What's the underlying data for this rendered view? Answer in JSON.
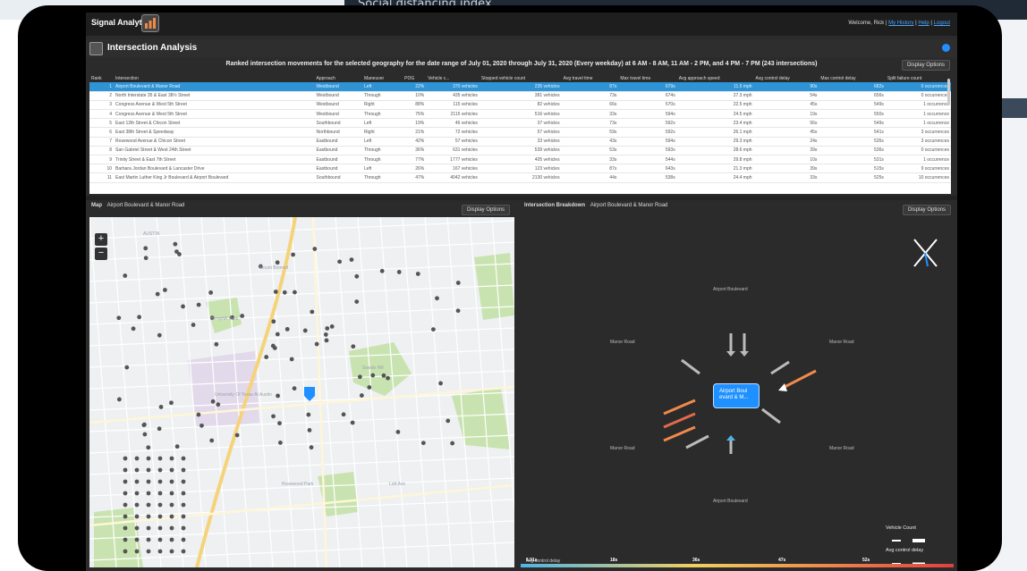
{
  "background": {
    "title": "Social distancing index"
  },
  "app": {
    "name": "Signal Analytics",
    "welcome": "Welcome, Rick |",
    "links": [
      "My History",
      "Help",
      "Logout"
    ],
    "accent": "#1e90ff"
  },
  "section": {
    "title": "Intersection Analysis"
  },
  "ranked_text": "Ranked intersection movements for the selected geography for the date range of July 01, 2020 through July 31, 2020 (Every weekday) at 6 AM - 8 AM, 11 AM - 2 PM, and 4 PM - 7 PM (243 intersections)",
  "display_options": "Display Options",
  "table": {
    "columns": [
      "Rank",
      "Intersection",
      "Approach",
      "Maneuver",
      "POG",
      "Vehicle c...",
      "Stopped vehicle count",
      "Avg travel time",
      "Max travel time",
      "Avg approach speed",
      "Avg control delay",
      "Max control delay",
      "Split failure count"
    ],
    "rows": [
      [
        "1",
        "Airport Boulevard & Manor Road",
        "Westbound",
        "Left",
        "22%",
        "370 vehicles",
        "235 vehicles",
        "87s",
        "679s",
        "11.5 mph",
        "90s",
        "682s",
        "0 occurrences"
      ],
      [
        "2",
        "North Interstate 35 & East 38½ Street",
        "Westbound",
        "Through",
        "10%",
        "435 vehicles",
        "381 vehicles",
        "73s",
        "674s",
        "27.3 mph",
        "54s",
        "656s",
        "0 occurrences"
      ],
      [
        "3",
        "Congress Avenue & West 5th Street",
        "Westbound",
        "Right",
        "88%",
        "115 vehicles",
        "82 vehicles",
        "66s",
        "570s",
        "22.5 mph",
        "45s",
        "549s",
        "1 occurrence"
      ],
      [
        "4",
        "Congress Avenue & West 5th Street",
        "Westbound",
        "Through",
        "75%",
        "2115 vehicles",
        "516 vehicles",
        "33s",
        "594s",
        "24.5 mph",
        "19s",
        "550s",
        "1 occurrence"
      ],
      [
        "5",
        "East 12th Street & Chicon Street",
        "Southbound",
        "Left",
        "19%",
        "46 vehicles",
        "37 vehicles",
        "73s",
        "592s",
        "23.4 mph",
        "56s",
        "549s",
        "1 occurrence"
      ],
      [
        "6",
        "East 38th Street & Speedway",
        "Northbound",
        "Right",
        "21%",
        "72 vehicles",
        "57 vehicles",
        "59s",
        "592s",
        "26.1 mph",
        "45s",
        "541s",
        "3 occurrences"
      ],
      [
        "7",
        "Rosewood Avenue & Chicon Street",
        "Eastbound",
        "Left",
        "42%",
        "57 vehicles",
        "33 vehicles",
        "43s",
        "594s",
        "29.3 mph",
        "24s",
        "535s",
        "3 occurrences"
      ],
      [
        "8",
        "San Gabriel Street & West 24th Street",
        "Eastbound",
        "Through",
        "36%",
        "631 vehicles",
        "539 vehicles",
        "53s",
        "593s",
        "28.6 mph",
        "39s",
        "536s",
        "0 occurrences"
      ],
      [
        "9",
        "Trinity Street & East 7th Street",
        "Eastbound",
        "Through",
        "77%",
        "1777 vehicles",
        "405 vehicles",
        "33s",
        "544s",
        "29.8 mph",
        "10s",
        "531s",
        "1 occurrence"
      ],
      [
        "10",
        "Barbara Jordan Boulevard & Lancaster Drive",
        "Eastbound",
        "Left",
        "26%",
        "167 vehicles",
        "123 vehicles",
        "87s",
        "643s",
        "21.3 mph",
        "39s",
        "515s",
        "9 occurrences"
      ],
      [
        "11",
        "East Martin Luther King Jr Boulevard & Airport Boulevard",
        "Southbound",
        "Through",
        "47%",
        "4042 vehicles",
        "2130 vehicles",
        "44s",
        "538s",
        "24.4 mph",
        "33s",
        "525s",
        "10 occurrences"
      ]
    ]
  },
  "map_panel": {
    "label": "Map",
    "intersection": "Airport Boulevard & Manor Road",
    "zoom_in": "+",
    "zoom_out": "−",
    "place_labels": [
      "AUSTIN",
      "University Of Texas At Austin",
      "Hemphill Park",
      "Mount Bonnell",
      "Swede Hill",
      "Rosewood Park",
      "Lott Ave"
    ]
  },
  "breakdown": {
    "label": "Intersection Breakdown",
    "intersection": "Airport Boulevard & Manor Road",
    "center": "Airport Boul evard & M...",
    "street_labels": [
      "Airport Boulevard",
      "Manor Road",
      "Manor Road",
      "Manor Road",
      "Manor Road",
      "Airport Boulevard"
    ],
    "vehicle_count": "Vehicle Count",
    "avg_control_delay": "Avg control delay",
    "delay_title": "Avg control delay",
    "delay_ticks": [
      "6.91s",
      "18s",
      "36s",
      "47s",
      "52s"
    ]
  }
}
